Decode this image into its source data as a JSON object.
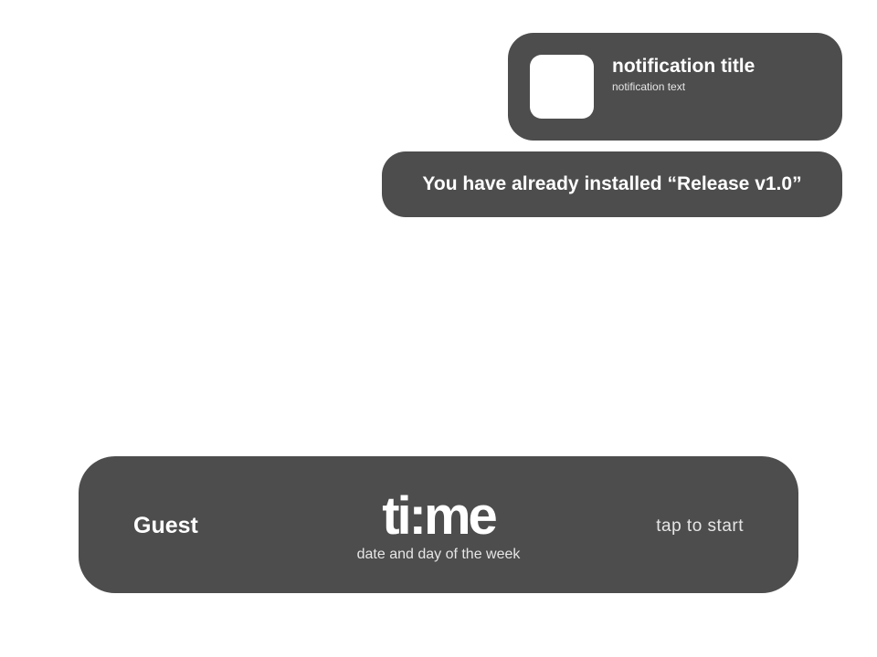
{
  "colors": {
    "panel": "#4d4d4d",
    "background": "#ffffff",
    "text_primary": "#ffffff",
    "text_secondary": "#e6e6e6"
  },
  "notification": {
    "title": "notification title",
    "text": "notification text",
    "icon": "app-icon-placeholder"
  },
  "toast": {
    "message": "You have already installed “Release v1.0”"
  },
  "lock_bar": {
    "user": "Guest",
    "time": "ti:me",
    "date": "date and day of the week",
    "action": "tap to start"
  }
}
